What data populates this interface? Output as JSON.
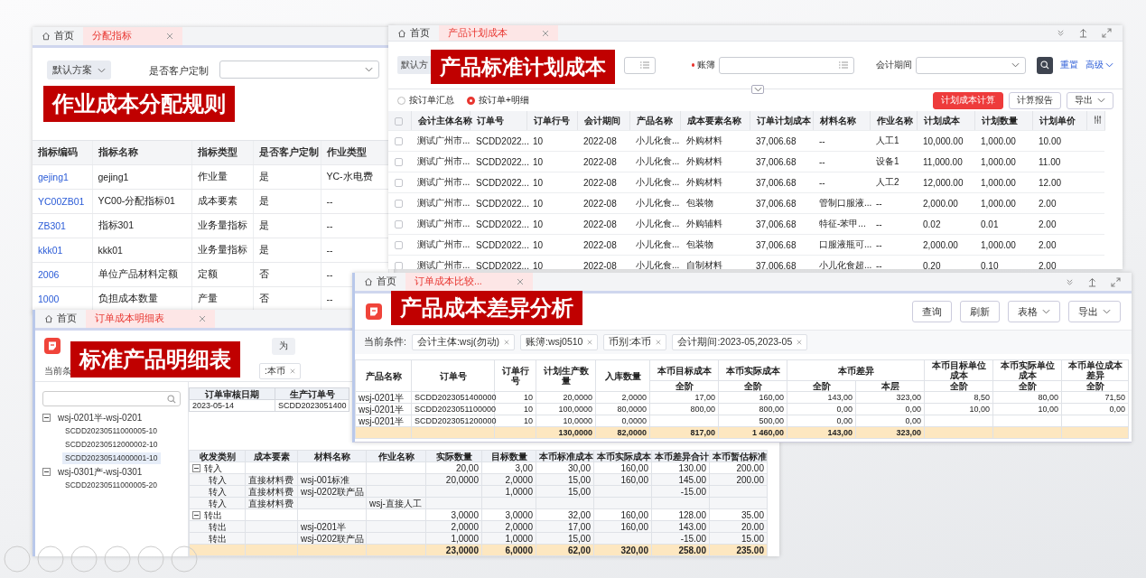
{
  "allocation_window": {
    "tabs": [
      {
        "label": "首页",
        "kind": "home",
        "selected": false
      },
      {
        "label": "分配指标",
        "kind": "page",
        "selected": true
      }
    ],
    "overlay_title": "作业成本分配规则",
    "scheme": "默认方案",
    "filter_label": "是否客户定制",
    "columns": [
      "指标编码",
      "指标名称",
      "指标类型",
      "是否客户定制",
      "作业类型"
    ],
    "rows": [
      [
        "gejing1",
        "gejing1",
        "作业量",
        "是",
        "YC-水电费"
      ],
      [
        "YC00ZB01",
        "YC00-分配指标01",
        "成本要素",
        "是",
        "--"
      ],
      [
        "ZB301",
        "指标301",
        "业务量指标",
        "是",
        "--"
      ],
      [
        "kkk01",
        "kkk01",
        "业务量指标",
        "是",
        "--"
      ],
      [
        "2006",
        "单位产品材料定额",
        "定额",
        "否",
        "--"
      ],
      [
        "1000",
        "负担成本数量",
        "产量",
        "否",
        "--"
      ]
    ]
  },
  "plan_cost_window": {
    "tabs": [
      {
        "label": "首页",
        "kind": "home",
        "selected": false
      },
      {
        "label": "产品计划成本",
        "kind": "page",
        "selected": true
      }
    ],
    "overlay_title": "产品标准计划成本",
    "scheme": "默认方",
    "filters": [
      {
        "label": "账簿",
        "required": true
      },
      {
        "label": "会计期间",
        "required": false
      }
    ],
    "links": [
      "重置",
      "高级"
    ],
    "view_options": [
      {
        "label": "按订单汇总",
        "selected": false
      },
      {
        "label": "按订单+明细",
        "selected": true
      }
    ],
    "buttons": [
      {
        "label": "计划成本计算",
        "kind": "primary"
      },
      {
        "label": "计算报告",
        "kind": "default"
      },
      {
        "label": "导出",
        "kind": "dropdown"
      }
    ],
    "all_checked": false,
    "columns": [
      "会计主体名称",
      "订单号",
      "订单行号",
      "会计期间",
      "产品名称",
      "成本要素名称",
      "订单计划成本",
      "材料名称",
      "作业名称",
      "计划成本",
      "计划数量",
      "计划单价"
    ],
    "rows": [
      {
        "checked": false,
        "cells": [
          "测试广州市...",
          "SCDD2022...",
          "10",
          "2022-08",
          "小儿化食...",
          "外购材料",
          "37,006.68",
          "--",
          "人工1",
          "10,000.00",
          "1,000.00",
          "10.00"
        ]
      },
      {
        "checked": false,
        "cells": [
          "测试广州市...",
          "SCDD2022...",
          "10",
          "2022-08",
          "小儿化食...",
          "外购材料",
          "37,006.68",
          "--",
          "设备1",
          "11,000.00",
          "1,000.00",
          "11.00"
        ]
      },
      {
        "checked": false,
        "cells": [
          "测试广州市...",
          "SCDD2022...",
          "10",
          "2022-08",
          "小儿化食...",
          "外购材料",
          "37,006.68",
          "--",
          "人工2",
          "12,000.00",
          "1,000.00",
          "12.00"
        ]
      },
      {
        "checked": false,
        "cells": [
          "测试广州市...",
          "SCDD2022...",
          "10",
          "2022-08",
          "小儿化食...",
          "包装物",
          "37,006.68",
          "管制口服液...",
          "--",
          "2,000.00",
          "1,000.00",
          "2.00"
        ]
      },
      {
        "checked": false,
        "cells": [
          "测试广州市...",
          "SCDD2022...",
          "10",
          "2022-08",
          "小儿化食...",
          "外购辅料",
          "37,006.68",
          "特征-苯甲...",
          "--",
          "0.02",
          "0.01",
          "2.00"
        ]
      },
      {
        "checked": false,
        "cells": [
          "测试广州市...",
          "SCDD2022...",
          "10",
          "2022-08",
          "小儿化食...",
          "包装物",
          "37,006.68",
          "口服液瓶可...",
          "--",
          "2,000.00",
          "1,000.00",
          "2.00"
        ]
      },
      {
        "checked": false,
        "cells": [
          "测试广州市...",
          "SCDD2022...",
          "10",
          "2022-08",
          "小儿化食...",
          "自制材料",
          "37,006.68",
          "小儿化食超...",
          "--",
          "0.20",
          "0.10",
          "2.00"
        ]
      }
    ]
  },
  "detail_window": {
    "tabs": [
      {
        "label": "首页",
        "kind": "home",
        "selected": false
      },
      {
        "label": "订单成本明细表",
        "kind": "page",
        "selected": true
      }
    ],
    "overlay_title": "标准产品明细表",
    "toolbar_button": "为",
    "condition_label": "当前条",
    "condition_tag": ":本币",
    "tree": [
      {
        "label": "wsj-0201半-wsj-0201",
        "selected": false,
        "expanded": true,
        "children": [
          {
            "label": "SCDD20230511000005-10",
            "selected": false
          },
          {
            "label": "SCDD20230512000002-10",
            "selected": false
          },
          {
            "label": "SCDD20230514000001-10",
            "selected": true
          }
        ]
      },
      {
        "label": "wsj-0301产-wsj-0301",
        "selected": false,
        "expanded": true,
        "children": [
          {
            "label": "SCDD20230511000005-20",
            "selected": false
          }
        ]
      }
    ],
    "header_grid": {
      "columns": [
        "订单审核日期",
        "生产订单号"
      ],
      "row": [
        "2023-05-14",
        "SCDD2023051400"
      ]
    },
    "columns": [
      "收发类别",
      "成本要素",
      "材料名称",
      "作业名称",
      "实际数量",
      "目标数量",
      "本币标准成本",
      "本币实际成本",
      "本币差异合计",
      "本币暂估标准"
    ],
    "groups": [
      {
        "category": "转入",
        "expanded": true,
        "actual_qty": "20,00",
        "target_qty": "3,00",
        "std_cost": "30,00",
        "actual_cost": "160,00",
        "variance_total": "130.00",
        "estimated_std": "200.00",
        "children": [
          {
            "category": "转入",
            "element": "直接材料费",
            "material": "wsj-001标准",
            "actual_qty": "20,0000",
            "target_qty": "2,0000",
            "std_cost": "15,00",
            "actual_cost": "160,00",
            "variance_total": "145.00",
            "estimated_std": "200.00"
          },
          {
            "category": "转入",
            "element": "直接材料费",
            "material": "wsj-0202联产品",
            "target_qty": "1,0000",
            "std_cost": "15,00",
            "variance_total": "-15.00"
          },
          {
            "category": "转入",
            "element": "直接材料费",
            "activity": "wsj-直接人工"
          }
        ]
      },
      {
        "category": "转出",
        "expanded": true,
        "actual_qty": "3,0000",
        "target_qty": "3,0000",
        "std_cost": "32,00",
        "actual_cost": "160,00",
        "variance_total": "128.00",
        "estimated_std": "35.00",
        "children": [
          {
            "category": "转出",
            "material": "wsj-0201半",
            "actual_qty": "2,0000",
            "target_qty": "2,0000",
            "std_cost": "17,00",
            "actual_cost": "160,00",
            "variance_total": "143.00",
            "estimated_std": "20.00"
          },
          {
            "category": "转出",
            "material": "wsj-0202联产品",
            "actual_qty": "1,0000",
            "target_qty": "1,0000",
            "std_cost": "15,00",
            "variance_total": "-15.00",
            "estimated_std": "15.00"
          }
        ]
      }
    ],
    "totals": {
      "actual_qty": "23,0000",
      "target_qty": "6,0000",
      "std_cost": "62,00",
      "actual_cost": "320,00",
      "variance_total": "258.00",
      "estimated_std": "235.00"
    }
  },
  "variance_window": {
    "tabs": [
      {
        "label": "首页",
        "kind": "home",
        "selected": false
      },
      {
        "label": "订单成本比较...",
        "kind": "page",
        "selected": true
      }
    ],
    "overlay_title": "产品成本差异分析",
    "buttons": [
      {
        "label": "查询",
        "kind": "default"
      },
      {
        "label": "刷新",
        "kind": "default"
      },
      {
        "label": "表格",
        "kind": "dropdown"
      },
      {
        "label": "导出",
        "kind": "dropdown"
      }
    ],
    "condition_label": "当前条件:",
    "tags": [
      "会计主体:wsj(勿动)",
      "账簿:wsj0510",
      "币别:本币",
      "会计期间:2023-05,2023-05"
    ],
    "columns": [
      {
        "label": "产品名称"
      },
      {
        "label": "订单号"
      },
      {
        "label": "订单行号"
      },
      {
        "label": "计划生产数量"
      },
      {
        "label": "入库数量"
      },
      {
        "label": "本币目标成本",
        "sub": [
          "全阶"
        ]
      },
      {
        "label": "本币实际成本",
        "sub": [
          "全阶"
        ]
      },
      {
        "label": "本币差异",
        "colspan": 2,
        "sub": [
          "全阶",
          "本层"
        ]
      },
      {
        "label": "本币目标单位成本",
        "sub": [
          "全阶"
        ]
      },
      {
        "label": "本币实际单位成本",
        "sub": [
          "全阶"
        ]
      },
      {
        "label": "本币单位成本差异",
        "sub": [
          "全阶"
        ]
      }
    ],
    "rows": [
      {
        "product": "wsj-0201半",
        "order_no": "SCDD2023051400000",
        "line_no": "10",
        "planned_qty": "20,0000",
        "received_qty": "2,0000",
        "target_cost": "17,00",
        "actual_cost": "160,00",
        "variance_all": "143,00",
        "variance_level": "323,00",
        "target_unit_cost": "8,50",
        "actual_unit_cost": "80,00",
        "unit_cost_variance": "71,50"
      },
      {
        "product": "wsj-0201半",
        "order_no": "SCDD2023051100000",
        "line_no": "10",
        "planned_qty": "100,0000",
        "received_qty": "80,0000",
        "target_cost": "800,00",
        "actual_cost": "800,00",
        "variance_all": "0,00",
        "variance_level": "0,00",
        "target_unit_cost": "10,00",
        "actual_unit_cost": "10,00",
        "unit_cost_variance": "0,00"
      },
      {
        "product": "wsj-0201半",
        "order_no": "SCDD2023051200000",
        "line_no": "10",
        "planned_qty": "10,0000",
        "received_qty": "0,0000",
        "actual_cost": "500,00",
        "variance_all": "0,00",
        "variance_level": "0,00"
      }
    ],
    "totals": {
      "planned_qty": "130,0000",
      "received_qty": "82,0000",
      "target_cost": "817,00",
      "actual_cost": "1 460,00",
      "variance_all": "143,00",
      "variance_level": "323,00"
    }
  }
}
